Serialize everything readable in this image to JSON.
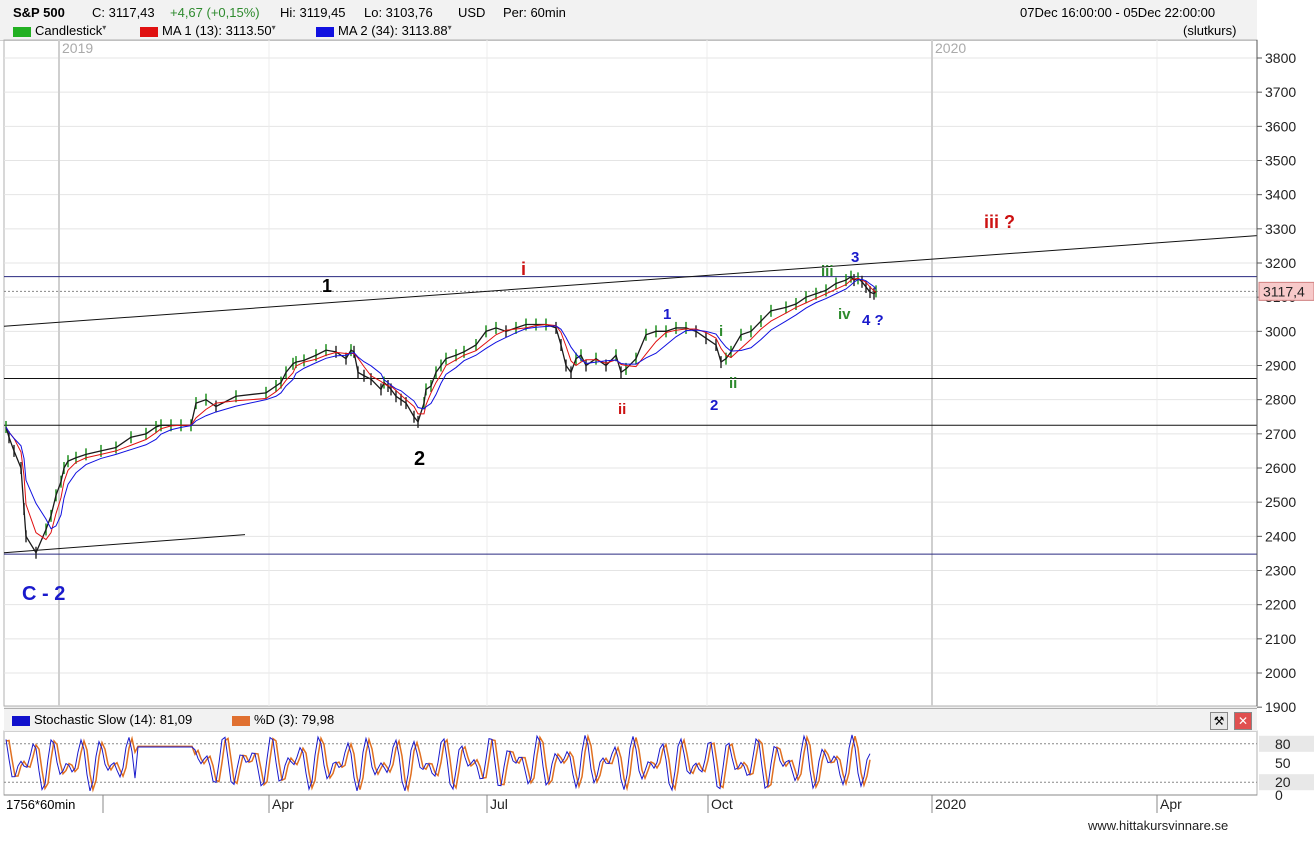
{
  "header": {
    "ticker": "S&P 500",
    "close": "C: 3117,43",
    "change": "+4,67 (+0,15%)",
    "high": "Hi: 3119,45",
    "low": "Lo: 3103,76",
    "currency": "USD",
    "period": "Per: 60min",
    "range": "07Dec 16:00:00 - 05Dec 22:00:00",
    "mode": "(slutkurs)",
    "legend": [
      {
        "label": "Candlestick",
        "color": "#22b022"
      },
      {
        "label": "MA 1 (13): 3113.50",
        "color": "#e01010"
      },
      {
        "label": "MA 2 (34): 3113.88",
        "color": "#1010e0"
      }
    ]
  },
  "chart_data": [
    {
      "type": "line",
      "subtype": "candlestick",
      "title": "S&P 500",
      "ylim": [
        1900,
        3850
      ],
      "y_ticks": [
        "3800",
        "3700",
        "3600",
        "3500",
        "3400",
        "3300",
        "3200",
        "3100",
        "3000",
        "2900",
        "2800",
        "2700",
        "2600",
        "2500",
        "2400",
        "2300",
        "2200",
        "2100",
        "2000",
        "1900"
      ],
      "last_price_label": "3117,4",
      "x_year_labels": [
        "2019",
        "2020"
      ],
      "x_ticks": [
        "Apr",
        "Jul",
        "Oct",
        "2020",
        "Apr"
      ],
      "horizontal_levels": [
        3160,
        3117,
        2862,
        2725,
        2348
      ],
      "series": [
        {
          "name": "Candlestick",
          "color": "#1a1a1a",
          "x": [
            0,
            3,
            8,
            15,
            18,
            20,
            30,
            40,
            45,
            50,
            55,
            58,
            62,
            70,
            80,
            95,
            110,
            125,
            140,
            150,
            155,
            165,
            175,
            185,
            190,
            200,
            210,
            230,
            260,
            270,
            275,
            280,
            287,
            290,
            298,
            310,
            320,
            330,
            340,
            345,
            348,
            352,
            358,
            365,
            375,
            378,
            382,
            385,
            390,
            395,
            400,
            408,
            412,
            418,
            420,
            425,
            430,
            435,
            440,
            450,
            458,
            470,
            480,
            490,
            500,
            510,
            520,
            530,
            540,
            550,
            555,
            560,
            565,
            570,
            575,
            580,
            590,
            600,
            610,
            615,
            620,
            630,
            640,
            650,
            660,
            670,
            680,
            690,
            700,
            710,
            715,
            720,
            725,
            735,
            745,
            755,
            765,
            780,
            790,
            800,
            810,
            820,
            830,
            840,
            845,
            848,
            852,
            856,
            860,
            864,
            868,
            870
          ],
          "values": [
            2720,
            2690,
            2650,
            2600,
            2480,
            2400,
            2352,
            2420,
            2460,
            2520,
            2560,
            2600,
            2620,
            2630,
            2640,
            2650,
            2660,
            2690,
            2700,
            2720,
            2725,
            2725,
            2725,
            2725,
            2790,
            2800,
            2780,
            2810,
            2820,
            2840,
            2850,
            2880,
            2905,
            2910,
            2915,
            2930,
            2945,
            2940,
            2920,
            2945,
            2940,
            2880,
            2870,
            2860,
            2830,
            2850,
            2840,
            2830,
            2810,
            2800,
            2790,
            2750,
            2735,
            2790,
            2830,
            2840,
            2880,
            2900,
            2920,
            2930,
            2940,
            2960,
            3000,
            3010,
            3000,
            3010,
            3020,
            3020,
            3020,
            3010,
            2960,
            2900,
            2880,
            2920,
            2930,
            2900,
            2920,
            2900,
            2930,
            2880,
            2890,
            2920,
            2990,
            3000,
            3000,
            3010,
            3010,
            3000,
            2980,
            2960,
            2910,
            2920,
            2940,
            2990,
            3000,
            3030,
            3060,
            3070,
            3080,
            3100,
            3110,
            3120,
            3140,
            3150,
            3160,
            3150,
            3155,
            3145,
            3130,
            3115,
            3110,
            3117
          ]
        },
        {
          "name": "MA 1 (13)",
          "color": "#e01010"
        },
        {
          "name": "MA 2 (34)",
          "color": "#1010e0"
        }
      ],
      "annotations": [
        {
          "text": "1",
          "color": "#000000"
        },
        {
          "text": "2",
          "color": "#000000"
        },
        {
          "text": "C - 2",
          "color": "#1a1acc"
        },
        {
          "text": "i",
          "color": "#cc1111"
        },
        {
          "text": "ii",
          "color": "#cc1111"
        },
        {
          "text": "iii ?",
          "color": "#cc1111"
        },
        {
          "text": "1",
          "color": "#1a1acc"
        },
        {
          "text": "2",
          "color": "#1a1acc"
        },
        {
          "text": "3",
          "color": "#1a1acc"
        },
        {
          "text": "4 ?",
          "color": "#1a1acc"
        },
        {
          "text": "i",
          "color": "#2e8b2e"
        },
        {
          "text": "ii",
          "color": "#2e8b2e"
        },
        {
          "text": "iii",
          "color": "#2e8b2e"
        },
        {
          "text": "iv",
          "color": "#2e8b2e"
        }
      ]
    },
    {
      "type": "line",
      "title": "Stochastic Slow (14): 81,09",
      "ylim": [
        0,
        100
      ],
      "y_ticks": [
        "80",
        "50",
        "20",
        "0"
      ],
      "levels": [
        80,
        20
      ],
      "series": [
        {
          "name": "Stochastic Slow (14): 81,09",
          "color": "#1a1acc"
        },
        {
          "name": "%D (3): 79,98",
          "color": "#e07020"
        }
      ]
    }
  ],
  "stoch_header": {
    "k_label": "Stochastic Slow (14): 81,09",
    "d_label": "%D (3): 79,98",
    "k_color": "#1010cc",
    "d_color": "#e07030"
  },
  "footer": {
    "bars_label": "1756*60min",
    "watermark": "www.hittakursvinnare.se"
  }
}
